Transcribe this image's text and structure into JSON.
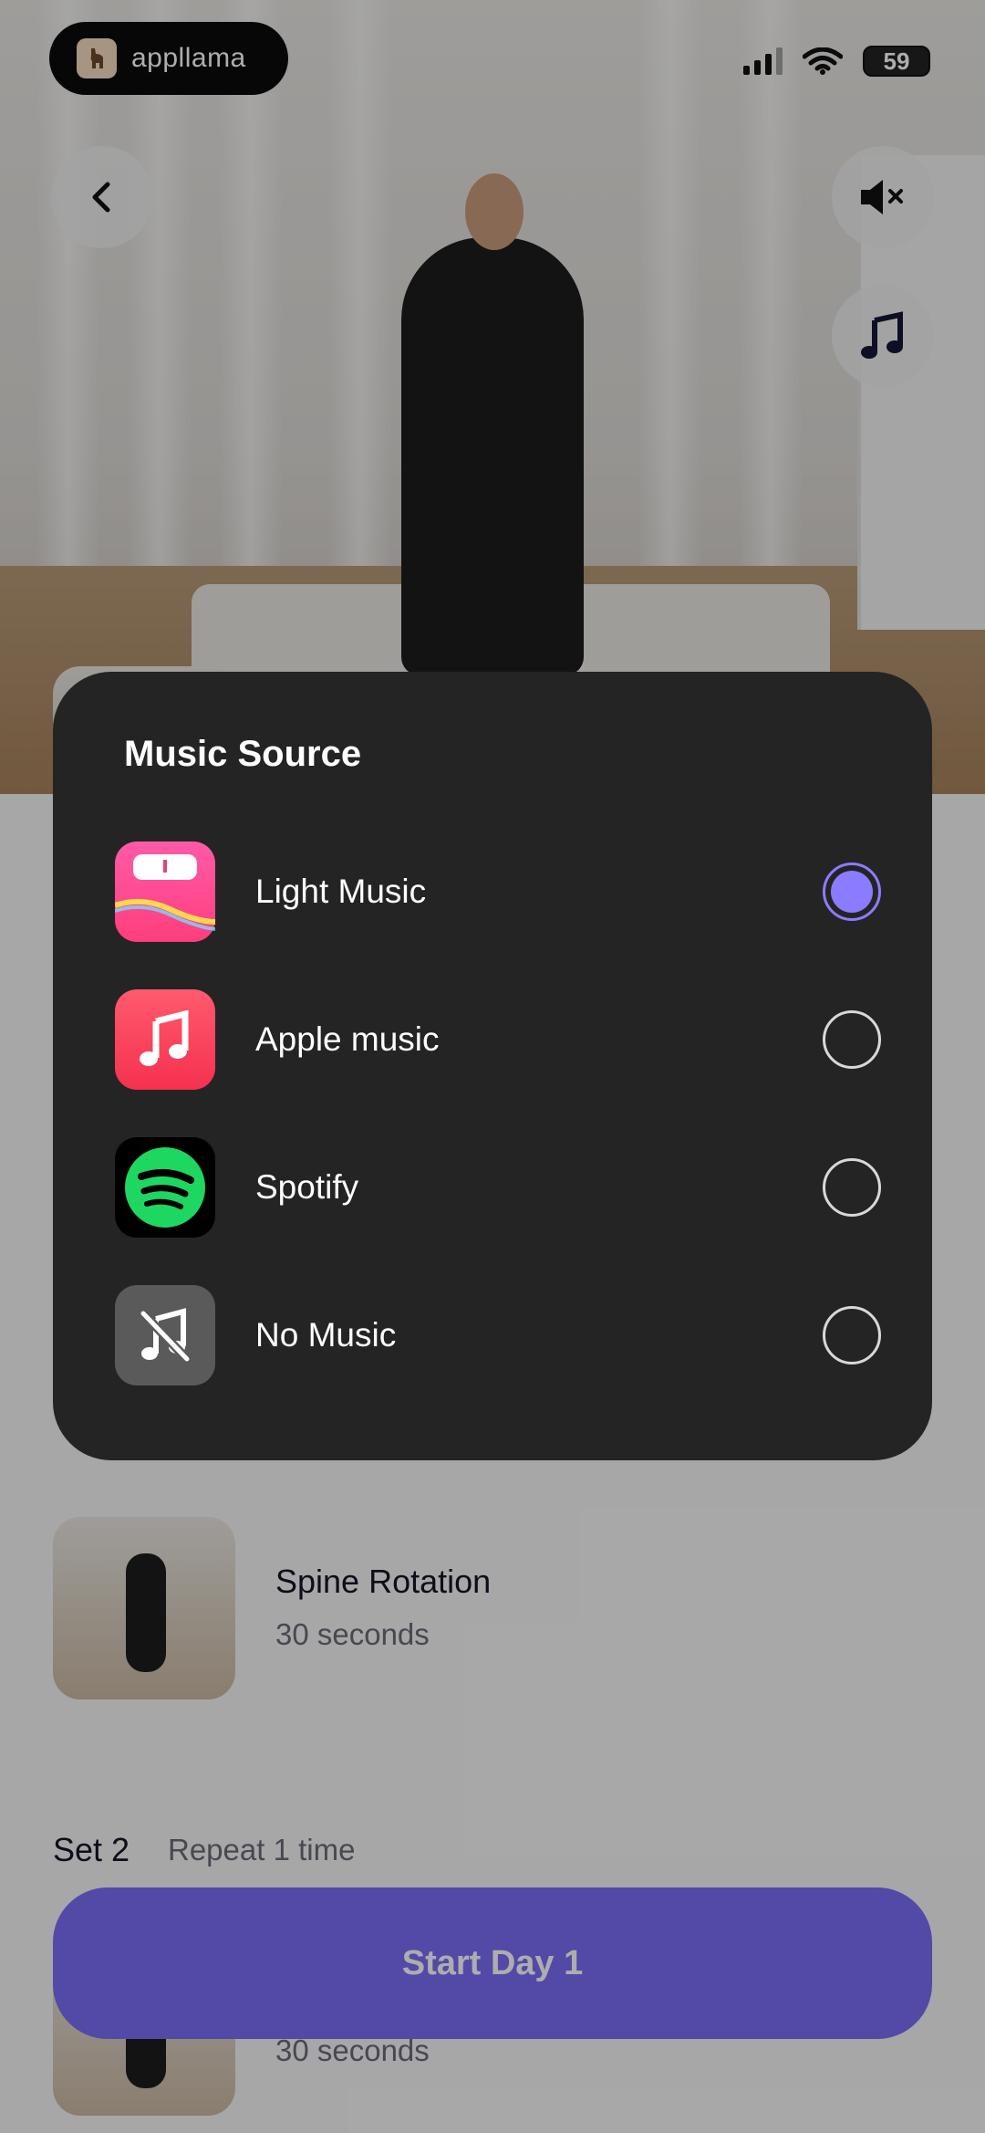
{
  "brand": {
    "name": "appllama",
    "logo_icon": "llama-icon"
  },
  "status_bar": {
    "battery": "59"
  },
  "buttons": {
    "back_icon": "chevron-left-icon",
    "mute_icon": "speaker-mute-icon",
    "music_icon": "music-note-icon"
  },
  "sheet": {
    "title": "Music Source",
    "options": [
      {
        "label": "Light Music",
        "icon": "scale-app-icon",
        "selected": true
      },
      {
        "label": "Apple music",
        "icon": "apple-music-icon",
        "selected": false
      },
      {
        "label": "Spotify",
        "icon": "spotify-icon",
        "selected": false
      },
      {
        "label": "No Music",
        "icon": "music-off-icon",
        "selected": false
      }
    ]
  },
  "exercises": [
    {
      "name": "Spine Rotation",
      "duration": "30 seconds"
    },
    {
      "duration": "30 seconds"
    }
  ],
  "set2": {
    "title": "Set 2",
    "repeat": "Repeat 1 time"
  },
  "cta": {
    "label": "Start Day 1"
  },
  "colors": {
    "accent": "#7b6cf6",
    "sheet_bg": "#242424"
  }
}
